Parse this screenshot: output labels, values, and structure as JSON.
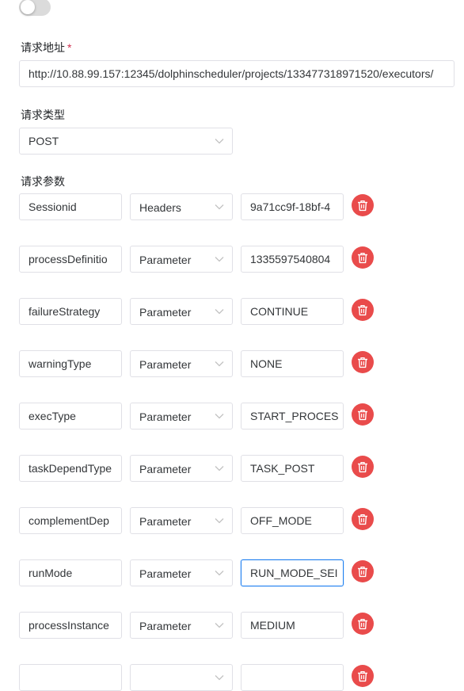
{
  "form": {
    "url_label": "请求地址",
    "required_mark": "*",
    "url_value": "http://10.88.99.157:12345/dolphinscheduler/projects/133477318971520/executors/",
    "method_label": "请求类型",
    "method_value": "POST",
    "params_label": "请求参数",
    "params": [
      {
        "name": "Sessionid",
        "type": "Headers",
        "value": "9a71cc9f-18bf-4"
      },
      {
        "name": "processDefinitio",
        "type": "Parameter",
        "value": "1335597540804"
      },
      {
        "name": "failureStrategy",
        "type": "Parameter",
        "value": "CONTINUE"
      },
      {
        "name": "warningType",
        "type": "Parameter",
        "value": "NONE"
      },
      {
        "name": "execType",
        "type": "Parameter",
        "value": "START_PROCES"
      },
      {
        "name": "taskDependType",
        "type": "Parameter",
        "value": "TASK_POST"
      },
      {
        "name": "complementDep",
        "type": "Parameter",
        "value": "OFF_MODE"
      },
      {
        "name": "runMode",
        "type": "Parameter",
        "value": "RUN_MODE_SEI"
      },
      {
        "name": "processInstance",
        "type": "Parameter",
        "value": "MEDIUM"
      },
      {
        "name": "",
        "type": "",
        "value": ""
      }
    ]
  },
  "colors": {
    "delete_button": "#e94b4b",
    "focus_border": "#2080f0",
    "required": "#d03050"
  },
  "icons": {
    "delete": "trash-icon",
    "select": "chevron-down-icon"
  }
}
